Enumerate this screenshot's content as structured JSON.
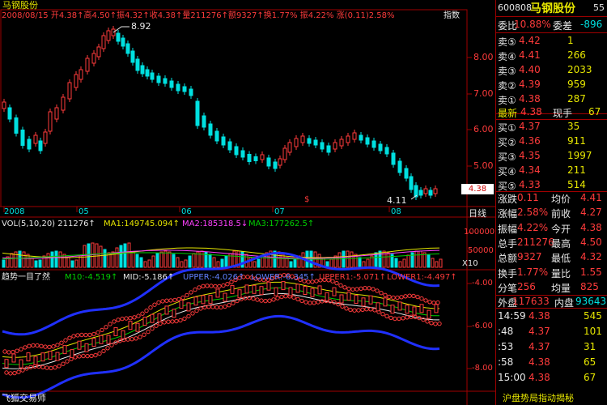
{
  "stock": {
    "code": "600808",
    "name": "马钢股份",
    "suffix": "55"
  },
  "header": {
    "name": "马钢股份",
    "line": "2008/08/15  开4.38↑高4.50↑振4.32↑收4.38↑量211276↑额9327↑换1.77%  振4.22%  涨(0.11)2.58%",
    "tail": "指数"
  },
  "price_chart": {
    "high_label": "8.92",
    "low_label": "4.11",
    "axis": [
      "8.00",
      "7.00",
      "6.00",
      "5.00"
    ],
    "current_price": "4.38",
    "dates": [
      "2008",
      "05",
      "06",
      "07",
      "08"
    ],
    "period": "日线",
    "marker": "$"
  },
  "volume_panel": {
    "legend": [
      "VOL(5,10,20) 211276↑",
      "MA1:149745.094↑",
      "MA2:185318.5↓",
      "MA3:177262.5↑"
    ],
    "axis": [
      "100000",
      "50000",
      "X10"
    ]
  },
  "indicator_panel": {
    "legend": [
      "趋势一目了然",
      "M10:-4.519↑",
      "MID:-5.186↑",
      "UPPER:-4.026↑",
      "LOWER:-6.345↑",
      "UPPER1:-5.071↑",
      "LOWER1:-4.497↑"
    ],
    "axis": [
      "-4.00",
      "-6.00",
      "-8.00"
    ]
  },
  "footer_left": "飞狐交易师",
  "side": {
    "weibi": {
      "label": "委比",
      "value": "10.88%",
      "label2": "委差",
      "value2": "-896"
    },
    "sells": [
      {
        "label": "卖⑤",
        "price": "4.42",
        "vol": "1"
      },
      {
        "label": "卖④",
        "price": "4.41",
        "vol": "266"
      },
      {
        "label": "卖③",
        "price": "4.40",
        "vol": "2033"
      },
      {
        "label": "卖②",
        "price": "4.39",
        "vol": "959"
      },
      {
        "label": "卖①",
        "price": "4.38",
        "vol": "287"
      }
    ],
    "latest": {
      "label": "最新",
      "price": "4.38",
      "label2": "现手",
      "vol": "67"
    },
    "buys": [
      {
        "label": "买①",
        "price": "4.37",
        "vol": "35"
      },
      {
        "label": "买②",
        "price": "4.36",
        "vol": "911"
      },
      {
        "label": "买③",
        "price": "4.35",
        "vol": "1997"
      },
      {
        "label": "买④",
        "price": "4.34",
        "vol": "211"
      },
      {
        "label": "买⑤",
        "price": "4.33",
        "vol": "514"
      }
    ],
    "stats": [
      {
        "l1": "涨跌",
        "v1": "0.11",
        "l2": "均价",
        "v2": "4.41"
      },
      {
        "l1": "涨幅",
        "v1": "2.58%",
        "l2": "前收",
        "v2": "4.27"
      },
      {
        "l1": "振幅",
        "v1": "4.22%",
        "l2": "今开",
        "v2": "4.38"
      },
      {
        "l1": "总手",
        "v1": "211276",
        "l2": "最高",
        "v2": "4.50"
      },
      {
        "l1": "总额",
        "v1": "9327",
        "l2": "最低",
        "v2": "4.32"
      },
      {
        "l1": "换手",
        "v1": "1.77%",
        "l2": "量比",
        "v2": "1.55"
      },
      {
        "l1": "分笔",
        "v1": "256",
        "l2": "均量",
        "v2": "825"
      }
    ],
    "outer_inner": {
      "l1": "外盘",
      "v1": "117633",
      "l2": "内盘",
      "v2": "93643"
    },
    "ticks": [
      {
        "time": "14:59",
        "price": "4.38",
        "vol": "545"
      },
      {
        "time": ":48",
        "price": "4.37",
        "vol": "101"
      },
      {
        "time": ":53",
        "price": "4.37",
        "vol": "31"
      },
      {
        "time": ":58",
        "price": "4.38",
        "vol": "65"
      },
      {
        "time": "15:00",
        "price": "4.38",
        "vol": "67"
      }
    ],
    "footer": "沪盘势局指动揭秘"
  },
  "colors": {
    "up": "#ff3b3b",
    "down": "#00e0e0",
    "bg": "#000000",
    "grid": "#a00000"
  }
}
